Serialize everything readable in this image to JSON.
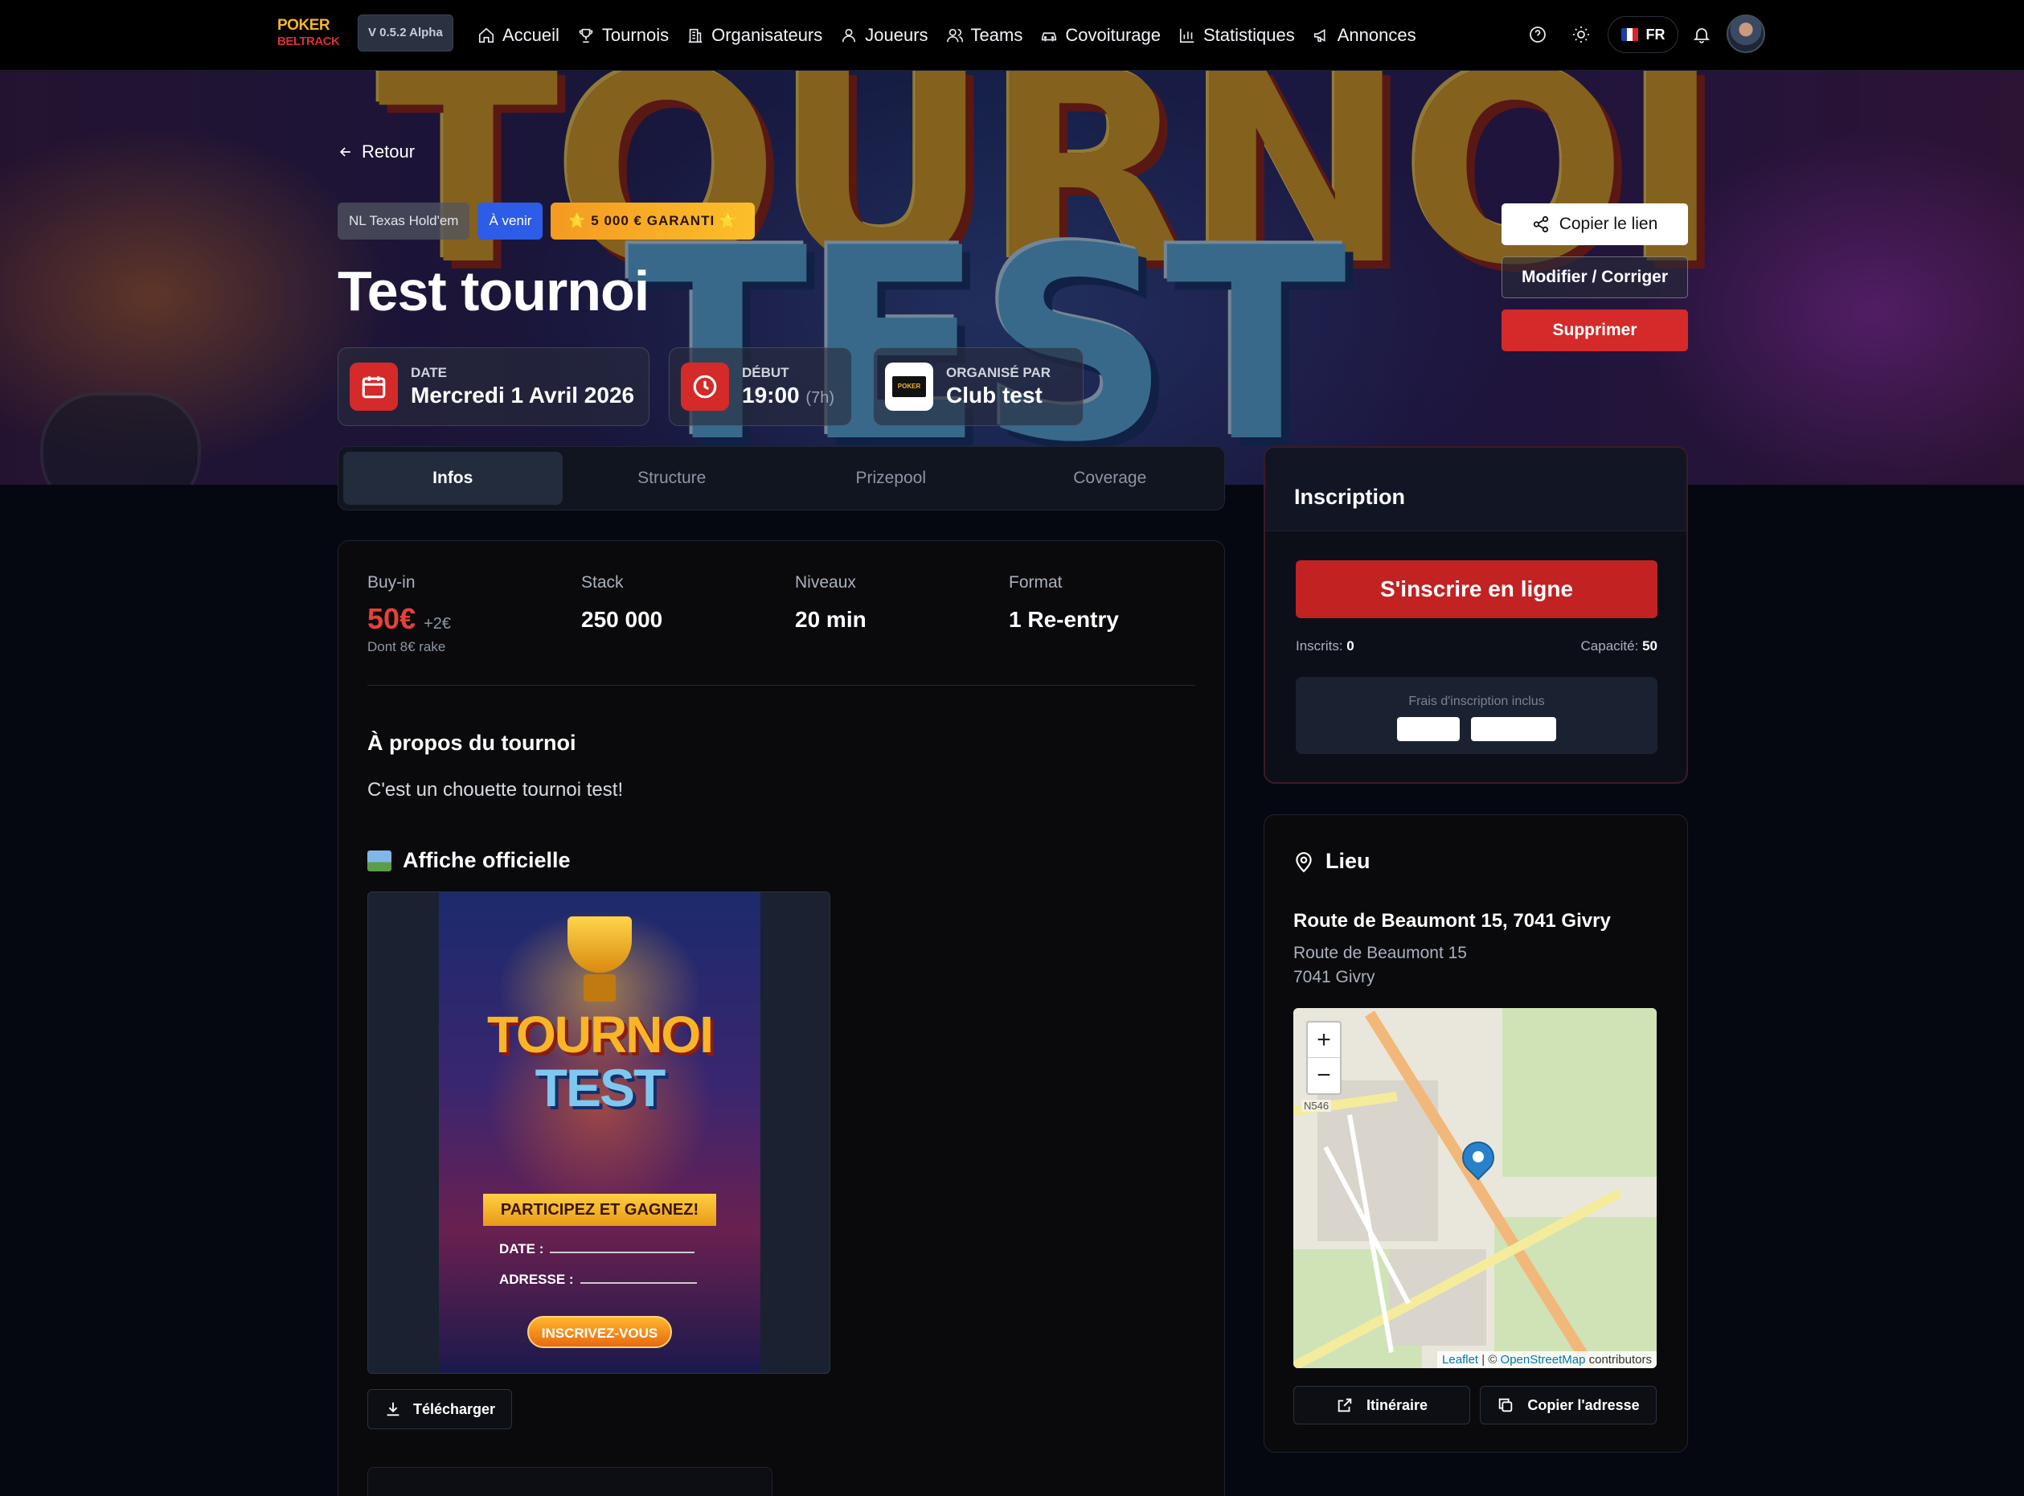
{
  "nav": {
    "logo_line1": "POKER",
    "logo_line2": "BELTRACK",
    "version": "V 0.5.2 Alpha",
    "links": [
      {
        "label": "Accueil",
        "icon": "home-icon"
      },
      {
        "label": "Tournois",
        "icon": "trophy-icon"
      },
      {
        "label": "Organisateurs",
        "icon": "building-icon"
      },
      {
        "label": "Joueurs",
        "icon": "user-icon"
      },
      {
        "label": "Teams",
        "icon": "users-icon"
      },
      {
        "label": "Covoiturage",
        "icon": "car-icon"
      },
      {
        "label": "Statistiques",
        "icon": "bar-chart-icon"
      },
      {
        "label": "Annonces",
        "icon": "megaphone-icon"
      }
    ],
    "language": "FR",
    "colors": {
      "flag_blue": "#1f3fa6",
      "flag_white": "#ffffff",
      "flag_red": "#e0222a"
    }
  },
  "hero": {
    "banner_word1": "TOURNOI",
    "banner_word2": "TEST",
    "back_label": "Retour",
    "badge_game": "NL Texas Hold'em",
    "badge_status": "À venir",
    "badge_guarantee": "⭐ 5 000 € GARANTI ⭐",
    "title": "Test tournoi",
    "date_label": "Date",
    "date_value": "Mercredi 1 Avril 2026",
    "start_label": "Début",
    "start_value": "19:00",
    "start_extra": "(7h)",
    "organizer_label": "Organisé par",
    "organizer_value": "Club test",
    "organizer_logo_text": "POKER",
    "copy_link_label": "Copier le lien",
    "edit_label": "Modifier / Corriger",
    "delete_label": "Supprimer"
  },
  "tabs": [
    "Infos",
    "Structure",
    "Prizepool",
    "Coverage"
  ],
  "stats": {
    "buyin_label": "Buy-in",
    "buyin_value": "50€",
    "buyin_extra": "+2€",
    "buyin_sub": "Dont 8€ rake",
    "stack_label": "Stack",
    "stack_value": "250 000",
    "levels_label": "Niveaux",
    "levels_value": "20 min",
    "format_label": "Format",
    "format_value": "1 Re-entry"
  },
  "about": {
    "title": "À propos du tournoi",
    "text": "C'est un chouette tournoi test!"
  },
  "poster": {
    "title": "Affiche officielle",
    "word1": "TOURNOI",
    "word2": "TEST",
    "ribbon": "PARTICIPEZ ET GAGNEZ!",
    "date_label": "DATE :",
    "address_label": "ADRESSE :",
    "cta": "INSCRIVEZ-VOUS",
    "download_label": "Télécharger"
  },
  "inscription": {
    "title": "Inscription",
    "button": "S'inscrire en ligne",
    "registered_label": "Inscrits:",
    "registered_value": "0",
    "capacity_label": "Capacité:",
    "capacity_value": "50",
    "fees_label": "Frais d'inscription inclus"
  },
  "lieu": {
    "title": "Lieu",
    "address_main": "Route de Beaumont 15, 7041 Givry",
    "address_line1": "Route de Beaumont 15",
    "address_line2": "7041 Givry",
    "map_zoom_in": "+",
    "map_zoom_out": "−",
    "map_label_n546": "N546",
    "map_attribution_leaflet": "Leaflet",
    "map_attribution_sep": " | © ",
    "map_attribution_osm": "OpenStreetMap",
    "map_attribution_tail": " contributors",
    "route_label": "Itinéraire",
    "copy_address_label": "Copier l'adresse"
  },
  "colors": {
    "accent_red": "#d42a2a",
    "status_blue": "#2d5ce6",
    "guarantee_orange": "#f49a22",
    "background": "#050811"
  }
}
